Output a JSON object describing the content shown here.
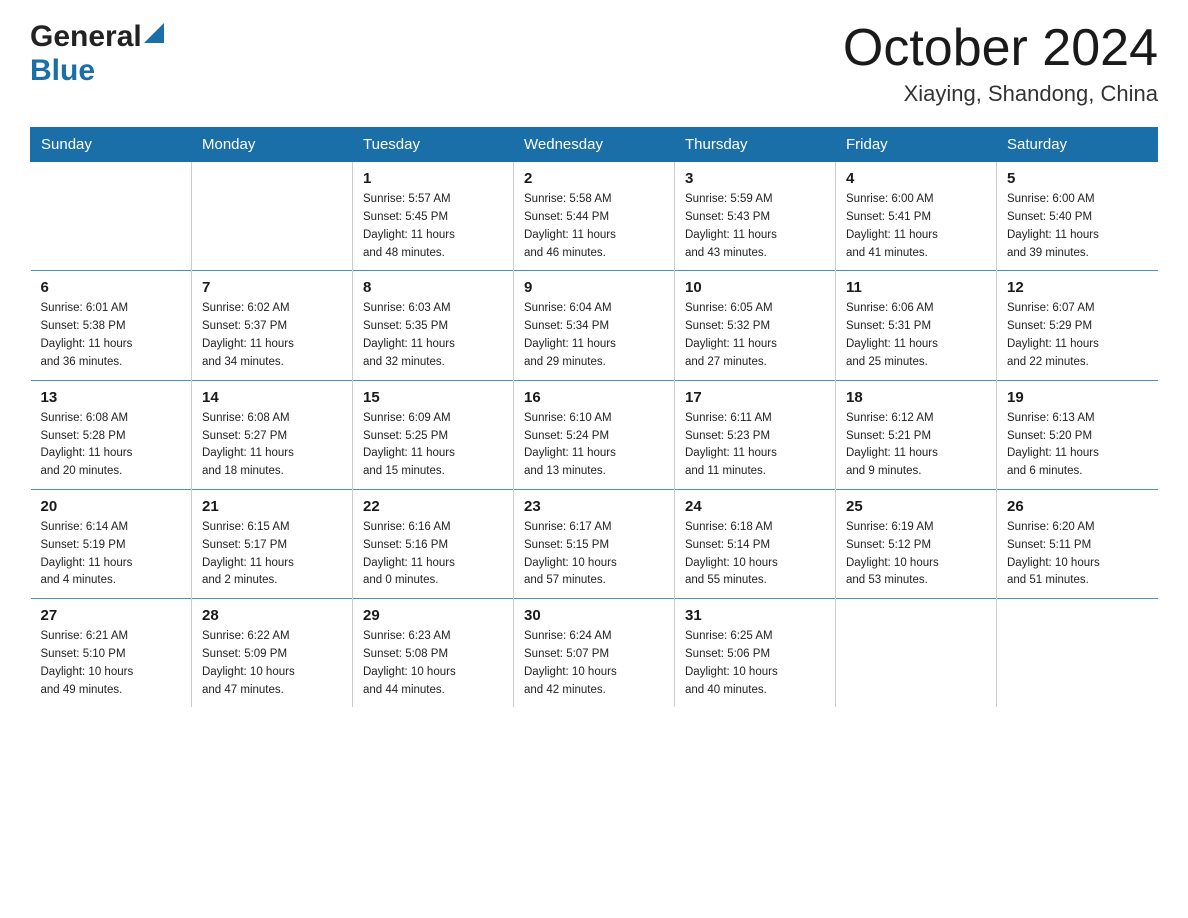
{
  "header": {
    "logo_general": "General",
    "logo_blue": "Blue",
    "month": "October 2024",
    "location": "Xiaying, Shandong, China"
  },
  "days_of_week": [
    "Sunday",
    "Monday",
    "Tuesday",
    "Wednesday",
    "Thursday",
    "Friday",
    "Saturday"
  ],
  "weeks": [
    [
      {
        "day": "",
        "info": ""
      },
      {
        "day": "",
        "info": ""
      },
      {
        "day": "1",
        "info": "Sunrise: 5:57 AM\nSunset: 5:45 PM\nDaylight: 11 hours\nand 48 minutes."
      },
      {
        "day": "2",
        "info": "Sunrise: 5:58 AM\nSunset: 5:44 PM\nDaylight: 11 hours\nand 46 minutes."
      },
      {
        "day": "3",
        "info": "Sunrise: 5:59 AM\nSunset: 5:43 PM\nDaylight: 11 hours\nand 43 minutes."
      },
      {
        "day": "4",
        "info": "Sunrise: 6:00 AM\nSunset: 5:41 PM\nDaylight: 11 hours\nand 41 minutes."
      },
      {
        "day": "5",
        "info": "Sunrise: 6:00 AM\nSunset: 5:40 PM\nDaylight: 11 hours\nand 39 minutes."
      }
    ],
    [
      {
        "day": "6",
        "info": "Sunrise: 6:01 AM\nSunset: 5:38 PM\nDaylight: 11 hours\nand 36 minutes."
      },
      {
        "day": "7",
        "info": "Sunrise: 6:02 AM\nSunset: 5:37 PM\nDaylight: 11 hours\nand 34 minutes."
      },
      {
        "day": "8",
        "info": "Sunrise: 6:03 AM\nSunset: 5:35 PM\nDaylight: 11 hours\nand 32 minutes."
      },
      {
        "day": "9",
        "info": "Sunrise: 6:04 AM\nSunset: 5:34 PM\nDaylight: 11 hours\nand 29 minutes."
      },
      {
        "day": "10",
        "info": "Sunrise: 6:05 AM\nSunset: 5:32 PM\nDaylight: 11 hours\nand 27 minutes."
      },
      {
        "day": "11",
        "info": "Sunrise: 6:06 AM\nSunset: 5:31 PM\nDaylight: 11 hours\nand 25 minutes."
      },
      {
        "day": "12",
        "info": "Sunrise: 6:07 AM\nSunset: 5:29 PM\nDaylight: 11 hours\nand 22 minutes."
      }
    ],
    [
      {
        "day": "13",
        "info": "Sunrise: 6:08 AM\nSunset: 5:28 PM\nDaylight: 11 hours\nand 20 minutes."
      },
      {
        "day": "14",
        "info": "Sunrise: 6:08 AM\nSunset: 5:27 PM\nDaylight: 11 hours\nand 18 minutes."
      },
      {
        "day": "15",
        "info": "Sunrise: 6:09 AM\nSunset: 5:25 PM\nDaylight: 11 hours\nand 15 minutes."
      },
      {
        "day": "16",
        "info": "Sunrise: 6:10 AM\nSunset: 5:24 PM\nDaylight: 11 hours\nand 13 minutes."
      },
      {
        "day": "17",
        "info": "Sunrise: 6:11 AM\nSunset: 5:23 PM\nDaylight: 11 hours\nand 11 minutes."
      },
      {
        "day": "18",
        "info": "Sunrise: 6:12 AM\nSunset: 5:21 PM\nDaylight: 11 hours\nand 9 minutes."
      },
      {
        "day": "19",
        "info": "Sunrise: 6:13 AM\nSunset: 5:20 PM\nDaylight: 11 hours\nand 6 minutes."
      }
    ],
    [
      {
        "day": "20",
        "info": "Sunrise: 6:14 AM\nSunset: 5:19 PM\nDaylight: 11 hours\nand 4 minutes."
      },
      {
        "day": "21",
        "info": "Sunrise: 6:15 AM\nSunset: 5:17 PM\nDaylight: 11 hours\nand 2 minutes."
      },
      {
        "day": "22",
        "info": "Sunrise: 6:16 AM\nSunset: 5:16 PM\nDaylight: 11 hours\nand 0 minutes."
      },
      {
        "day": "23",
        "info": "Sunrise: 6:17 AM\nSunset: 5:15 PM\nDaylight: 10 hours\nand 57 minutes."
      },
      {
        "day": "24",
        "info": "Sunrise: 6:18 AM\nSunset: 5:14 PM\nDaylight: 10 hours\nand 55 minutes."
      },
      {
        "day": "25",
        "info": "Sunrise: 6:19 AM\nSunset: 5:12 PM\nDaylight: 10 hours\nand 53 minutes."
      },
      {
        "day": "26",
        "info": "Sunrise: 6:20 AM\nSunset: 5:11 PM\nDaylight: 10 hours\nand 51 minutes."
      }
    ],
    [
      {
        "day": "27",
        "info": "Sunrise: 6:21 AM\nSunset: 5:10 PM\nDaylight: 10 hours\nand 49 minutes."
      },
      {
        "day": "28",
        "info": "Sunrise: 6:22 AM\nSunset: 5:09 PM\nDaylight: 10 hours\nand 47 minutes."
      },
      {
        "day": "29",
        "info": "Sunrise: 6:23 AM\nSunset: 5:08 PM\nDaylight: 10 hours\nand 44 minutes."
      },
      {
        "day": "30",
        "info": "Sunrise: 6:24 AM\nSunset: 5:07 PM\nDaylight: 10 hours\nand 42 minutes."
      },
      {
        "day": "31",
        "info": "Sunrise: 6:25 AM\nSunset: 5:06 PM\nDaylight: 10 hours\nand 40 minutes."
      },
      {
        "day": "",
        "info": ""
      },
      {
        "day": "",
        "info": ""
      }
    ]
  ]
}
